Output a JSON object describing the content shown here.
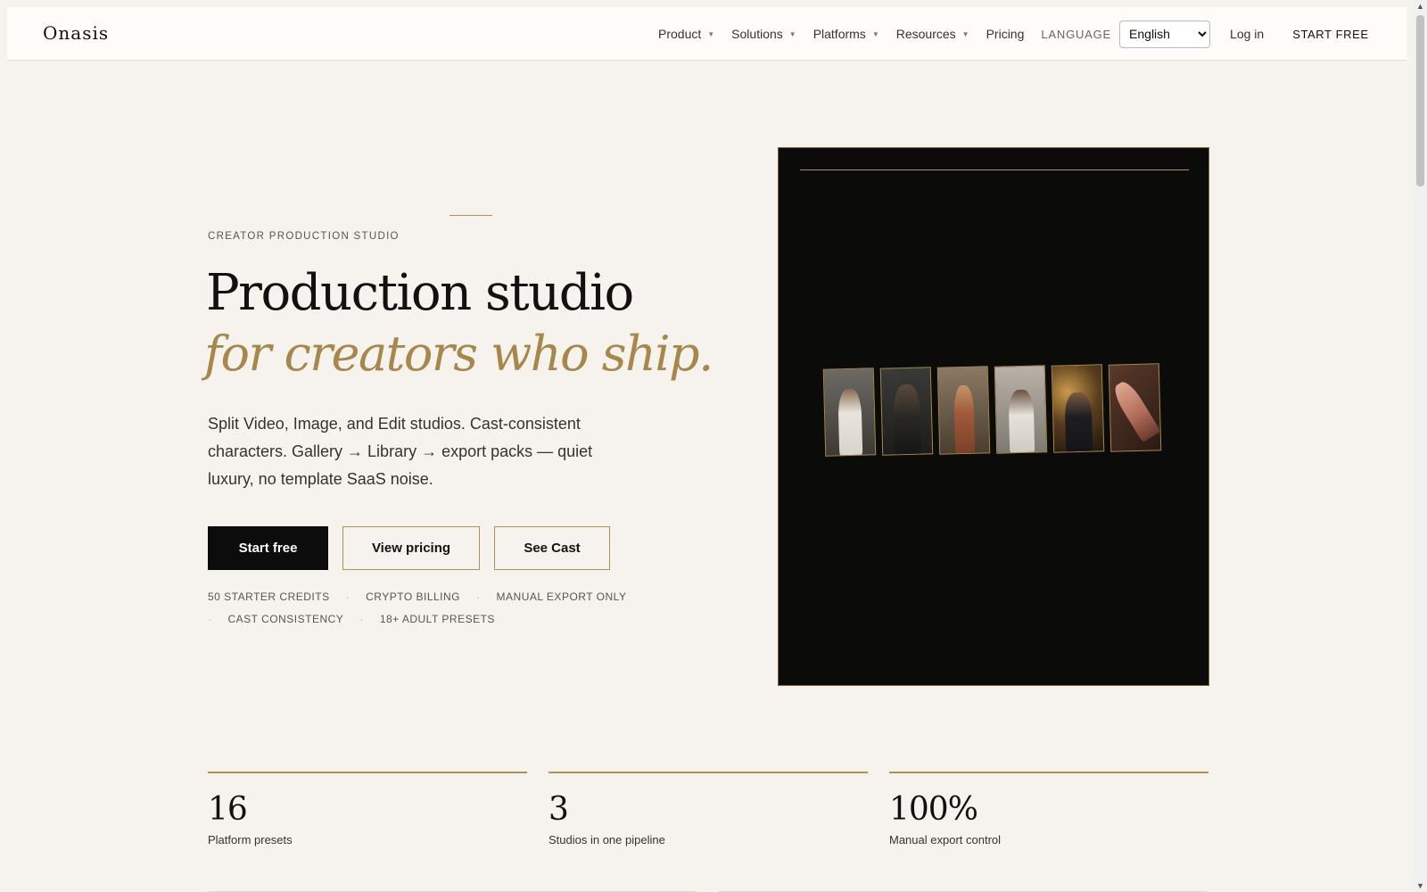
{
  "header": {
    "logo": "Onasis",
    "nav": [
      {
        "label": "Product",
        "has_caret": true
      },
      {
        "label": "Solutions",
        "has_caret": true
      },
      {
        "label": "Platforms",
        "has_caret": true
      },
      {
        "label": "Resources",
        "has_caret": true
      },
      {
        "label": "Pricing",
        "has_caret": false
      }
    ],
    "language_label": "LANGUAGE",
    "language_selected": "English",
    "login": "Log in",
    "start_free": "START FREE"
  },
  "hero": {
    "eyebrow": "CREATOR PRODUCTION STUDIO",
    "headline": "Production studio",
    "headline_italic": "for creators who ship.",
    "lead": "Split Video, Image, and Edit studios. Cast-consistent characters. Gallery → Library → export packs — quiet luxury, no template SaaS noise.",
    "cta_primary": "Start free",
    "cta_pricing": "View pricing",
    "cta_cast": "See Cast",
    "features": [
      "50 STARTER CREDITS",
      "CRYPTO BILLING",
      "MANUAL EXPORT ONLY",
      "CAST CONSISTENCY",
      "18+ ADULT PRESETS"
    ]
  },
  "stats": [
    {
      "value": "16",
      "label": "Platform presets"
    },
    {
      "value": "3",
      "label": "Studios in one pipeline"
    },
    {
      "value": "100%",
      "label": "Manual export control"
    }
  ],
  "colors": {
    "accent_gold": "#b3924f",
    "background": "#f6f3ef",
    "dark": "#0b0b0a"
  }
}
